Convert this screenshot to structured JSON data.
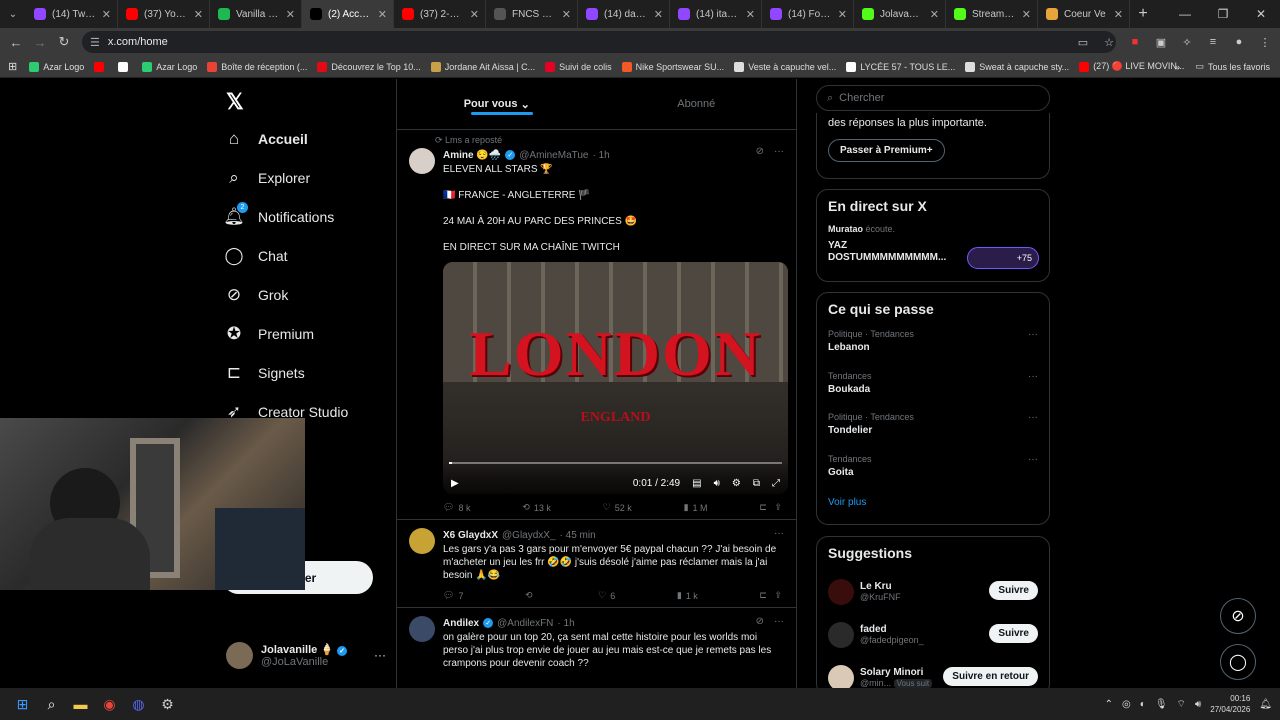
{
  "browser": {
    "tabs": [
      {
        "title": "(14) Twitch",
        "color": "#9146ff",
        "active": false
      },
      {
        "title": "(37) YouTube",
        "color": "#ff0000",
        "active": false
      },
      {
        "title": "Vanilla - play",
        "color": "#1db954",
        "active": false
      },
      {
        "title": "(2) Accueil /",
        "color": "#000000",
        "active": true
      },
      {
        "title": "(37) 2-Hours",
        "color": "#ff0000",
        "active": false
      },
      {
        "title": "FNCS Major",
        "color": "#555555",
        "active": false
      },
      {
        "title": "(14) darkosh",
        "color": "#9146ff",
        "active": false
      },
      {
        "title": "(14) itachi -",
        "color": "#9146ff",
        "active": false
      },
      {
        "title": "(14) Fortnite",
        "color": "#9146ff",
        "active": false
      },
      {
        "title": "Jolavanille S",
        "color": "#53fc18",
        "active": false
      },
      {
        "title": "Stream - Kick",
        "color": "#53fc18",
        "active": false
      },
      {
        "title": "Coeur Ve",
        "color": "#e8a33d",
        "active": false
      }
    ],
    "url": "x.com/home",
    "bookmarks": [
      {
        "label": "Azar Logo",
        "color": "#2ecc71"
      },
      {
        "label": "",
        "color": "#ff0000"
      },
      {
        "label": "",
        "color": "#ffffff"
      },
      {
        "label": "Azar Logo",
        "color": "#2ecc71"
      },
      {
        "label": "Boîte de réception (...",
        "color": "#ea4335"
      },
      {
        "label": "Découvrez le Top 10...",
        "color": "#e50914"
      },
      {
        "label": "Jordane Ait Aissa | C...",
        "color": "#c8a04a"
      },
      {
        "label": "Suivi de colis",
        "color": "#e60023"
      },
      {
        "label": "Nike Sportswear SU...",
        "color": "#f15a24"
      },
      {
        "label": "Veste à capuche vel...",
        "color": "#dddddd"
      },
      {
        "label": "LYCÉE 57 - TOUS LE...",
        "color": "#ffffff"
      },
      {
        "label": "Sweat à capuche sty...",
        "color": "#dddddd"
      },
      {
        "label": "(27) 🔴 LIVE MOVIN...",
        "color": "#ff0000"
      }
    ],
    "all_bookmarks": "Tous les favoris"
  },
  "nav": {
    "items": [
      {
        "label": "Accueil",
        "icon": "home-icon",
        "glyph": "⌂"
      },
      {
        "label": "Explorer",
        "icon": "search-icon",
        "glyph": "⌕"
      },
      {
        "label": "Notifications",
        "icon": "bell-icon",
        "glyph": "🔔︎"
      },
      {
        "label": "Chat",
        "icon": "chat-icon",
        "glyph": "◯"
      },
      {
        "label": "Grok",
        "icon": "grok-icon",
        "glyph": "⊘"
      },
      {
        "label": "Premium",
        "icon": "premium-icon",
        "glyph": "✪"
      },
      {
        "label": "Signets",
        "icon": "bookmark-icon",
        "glyph": "⊏"
      },
      {
        "label": "Creator Studio",
        "icon": "rocket-icon",
        "glyph": "➶"
      }
    ],
    "notif_count": "2",
    "post_button": "Poster",
    "account": {
      "name": "Jolavanille 🍦",
      "handle": "@JoLaVanille"
    }
  },
  "feed": {
    "tabs": [
      "Pour vous",
      "Abonné"
    ],
    "tweets": [
      {
        "repost": "Lms a reposté",
        "name": "Amine 😌🌧️",
        "handle": "@AmineMaTue",
        "time": "· 1h",
        "lines": [
          "ELEVEN ALL STARS 🏆",
          "🇫🇷 FRANCE - ANGLETERRE 🏴",
          "24 MAI À 20H AU PARC DES PRINCES 🤩",
          "EN DIRECT SUR MA CHAÎNE TWITCH"
        ],
        "video": {
          "title": "LONDON",
          "subtitle": "ENGLAND",
          "time": "0:01 / 2:49",
          "progress": 0.01
        },
        "stats": {
          "replies": "8 k",
          "reposts": "13 k",
          "likes": "52 k",
          "views": "1 M"
        }
      },
      {
        "name": "X6 GlaydxX",
        "handle": "@GlaydxX_",
        "time": "· 45 min",
        "text": "Les gars y'a pas 3 gars pour m'envoyer 5€ paypal chacun ?? J'ai besoin de m'acheter un jeu les frr 🤣🤣 j'suis désolé j'aime pas réclamer mais la j'ai besoin 🙏😂",
        "stats": {
          "replies": "7",
          "reposts": "",
          "likes": "6",
          "views": "1 k"
        }
      },
      {
        "name": "Andilex",
        "handle": "@AndilexFN",
        "time": "· 1h",
        "text": "on galère pour un top 20, ça sent mal cette histoire pour les worlds moi perso j'ai plus trop envie de jouer au jeu mais est-ce que je remets pas les crampons pour devenir coach ??"
      }
    ]
  },
  "sidebar": {
    "search_placeholder": "Chercher",
    "premium": {
      "text": "des réponses la plus importante.",
      "button": "Passer à Premium+"
    },
    "live": {
      "heading": "En direct sur X",
      "host": "Muratao",
      "status": "écoute.",
      "title": "YAZ DOSTUMMMMMMMMM...",
      "count": "+75"
    },
    "trends": {
      "heading": "Ce qui se passe",
      "items": [
        {
          "category": "Politique · Tendances",
          "name": "Lebanon"
        },
        {
          "category": "Tendances",
          "name": "Boukada"
        },
        {
          "category": "Politique · Tendances",
          "name": "Tondelier"
        },
        {
          "category": "Tendances",
          "name": "Goita"
        }
      ],
      "see_more": "Voir plus"
    },
    "suggestions": {
      "heading": "Suggestions",
      "items": [
        {
          "name": "Le Kru",
          "handle": "@KruFNF",
          "button": "Suivre",
          "color": "#3a0d0d"
        },
        {
          "name": "faded",
          "handle": "@fadedpigeon_",
          "button": "Suivre",
          "color": "#2a2a2a"
        },
        {
          "name": "Solary Minori",
          "handle": "@min...",
          "button": "Suivre en retour",
          "color": "#d9c9b6",
          "note": "Vous suit"
        }
      ]
    }
  },
  "taskbar": {
    "time": "00:16",
    "date": "27/04/2026"
  }
}
